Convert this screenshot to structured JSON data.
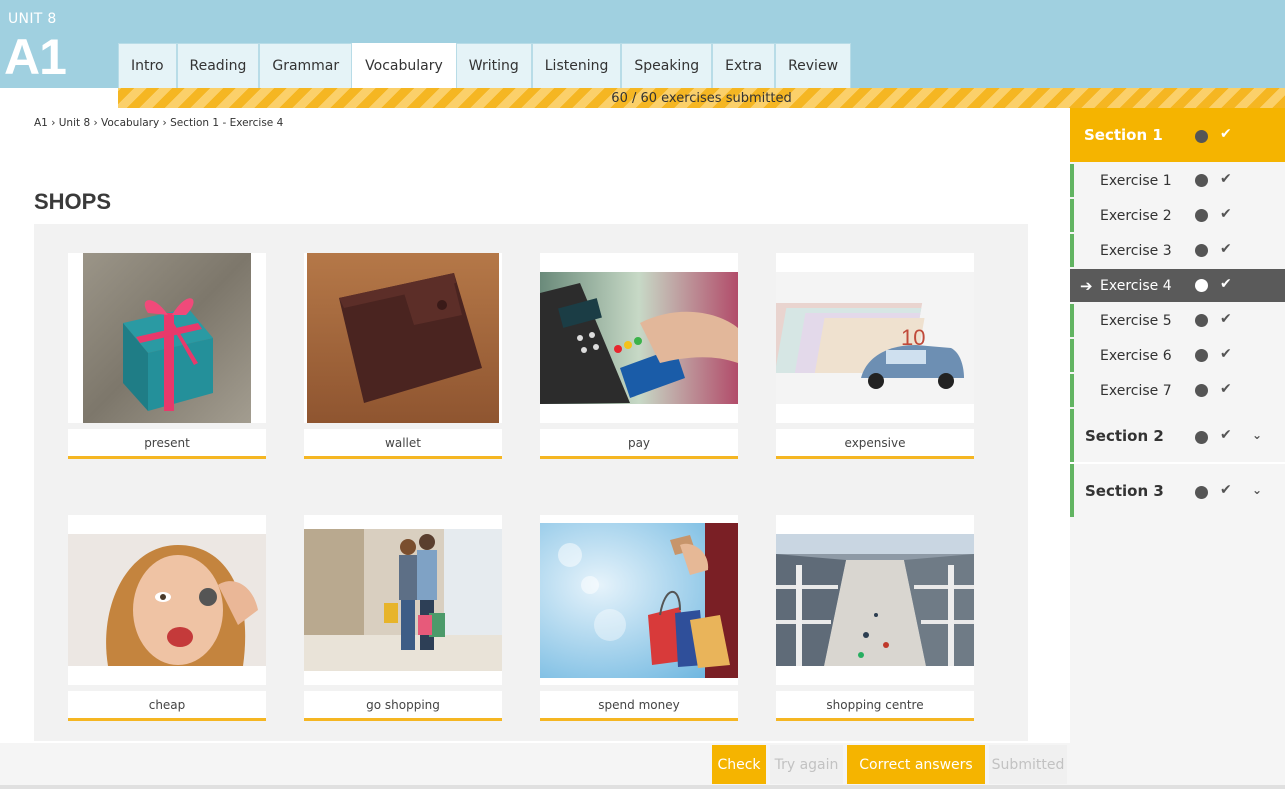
{
  "header": {
    "unit": "UNIT 8",
    "level": "A1"
  },
  "tabs": [
    {
      "label": "Intro"
    },
    {
      "label": "Reading"
    },
    {
      "label": "Grammar"
    },
    {
      "label": "Vocabulary"
    },
    {
      "label": "Writing"
    },
    {
      "label": "Listening"
    },
    {
      "label": "Speaking"
    },
    {
      "label": "Extra"
    },
    {
      "label": "Review"
    }
  ],
  "active_tab": "Vocabulary",
  "progress": {
    "text": "60 / 60 exercises submitted",
    "submitted": 60,
    "total": 60
  },
  "breadcrumb": "A1 › Unit 8 › Vocabulary › Section 1 - Exercise 4",
  "page_title": "SHOPS",
  "cards": [
    {
      "label": "present",
      "image": "gift-box-image"
    },
    {
      "label": "wallet",
      "image": "wallet-image"
    },
    {
      "label": "pay",
      "image": "card-payment-image"
    },
    {
      "label": "expensive",
      "image": "money-car-image"
    },
    {
      "label": "cheap",
      "image": "woman-coin-image"
    },
    {
      "label": "go shopping",
      "image": "couple-shopping-image"
    },
    {
      "label": "spend money",
      "image": "shopping-bags-image"
    },
    {
      "label": "shopping centre",
      "image": "mall-interior-image"
    }
  ],
  "sidebar": {
    "section1": {
      "label": "Section 1"
    },
    "exercises": [
      {
        "label": "Exercise 1"
      },
      {
        "label": "Exercise 2"
      },
      {
        "label": "Exercise 3"
      },
      {
        "label": "Exercise 4"
      },
      {
        "label": "Exercise 5"
      },
      {
        "label": "Exercise 6"
      },
      {
        "label": "Exercise 7"
      }
    ],
    "current_exercise": "Exercise 4",
    "section2": {
      "label": "Section 2"
    },
    "section3": {
      "label": "Section 3"
    }
  },
  "buttons": {
    "check": "Check",
    "try_again": "Try again",
    "correct_answers": "Correct answers",
    "submitted": "Submitted"
  },
  "colors": {
    "header": "#a0d0e0",
    "accent": "#f5b400",
    "completed": "#62b462",
    "current": "#5a5a5a"
  },
  "icons": {
    "status": "circle-icon",
    "done": "checkmark-icon",
    "expand": "chevron-down-icon",
    "current": "arrow-right-icon"
  }
}
